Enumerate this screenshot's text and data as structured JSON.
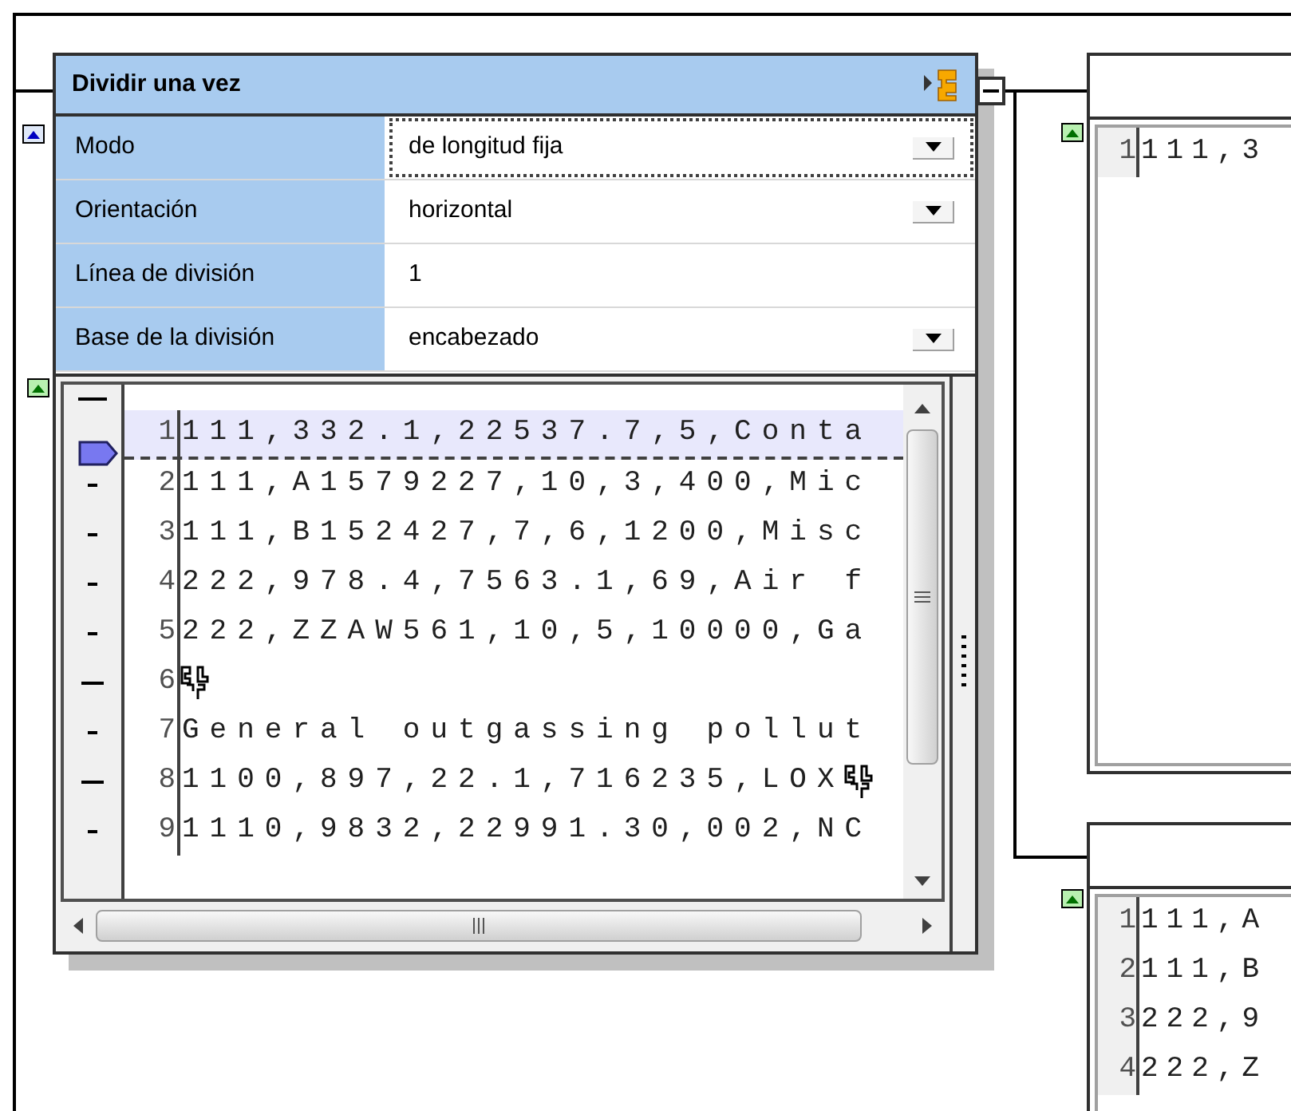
{
  "split_node": {
    "title": "Dividir una vez",
    "properties": [
      {
        "label": "Modo",
        "value": "de longitud fija",
        "kind": "dropdown",
        "focused": true
      },
      {
        "label": "Orientación",
        "value": "horizontal",
        "kind": "dropdown",
        "focused": false
      },
      {
        "label": "Línea de división",
        "value": "1",
        "kind": "text",
        "focused": false
      },
      {
        "label": "Base de la división",
        "value": "encabezado",
        "kind": "dropdown",
        "focused": false
      }
    ],
    "lines": [
      {
        "number": "1",
        "text": "111,332.1,22537.7,5,Conta",
        "highlighted": true,
        "eol": false
      },
      {
        "number": "2",
        "text": "111,A1579227,10,3,400,Mic",
        "highlighted": false,
        "eol": false
      },
      {
        "number": "3",
        "text": "111,B152427,7,6,1200,Misc",
        "highlighted": false,
        "eol": false
      },
      {
        "number": "4",
        "text": "222,978.4,7563.1,69,Air f",
        "highlighted": false,
        "eol": false
      },
      {
        "number": "5",
        "text": "222,ZZAW561,10,5,10000,Ga",
        "highlighted": false,
        "eol": false
      },
      {
        "number": "6",
        "highlighted": false,
        "eol": true
      },
      {
        "number": "7",
        "text": "General outgassing pollut",
        "highlighted": false,
        "eol": false
      },
      {
        "number": "8",
        "text": "1100,897,22.1,716235,LOX",
        "highlighted": false,
        "eol": true
      },
      {
        "number": "9",
        "text": "1110,9832,22991.30,002,NC",
        "highlighted": false,
        "eol": false
      }
    ]
  },
  "output_nodes": [
    {
      "lines": [
        {
          "number": "1",
          "text": "111,3"
        }
      ]
    },
    {
      "lines": [
        {
          "number": "1",
          "text": "111,A"
        },
        {
          "number": "2",
          "text": "111,B"
        },
        {
          "number": "3",
          "text": "222,9"
        },
        {
          "number": "4",
          "text": "222,Z"
        }
      ]
    }
  ]
}
